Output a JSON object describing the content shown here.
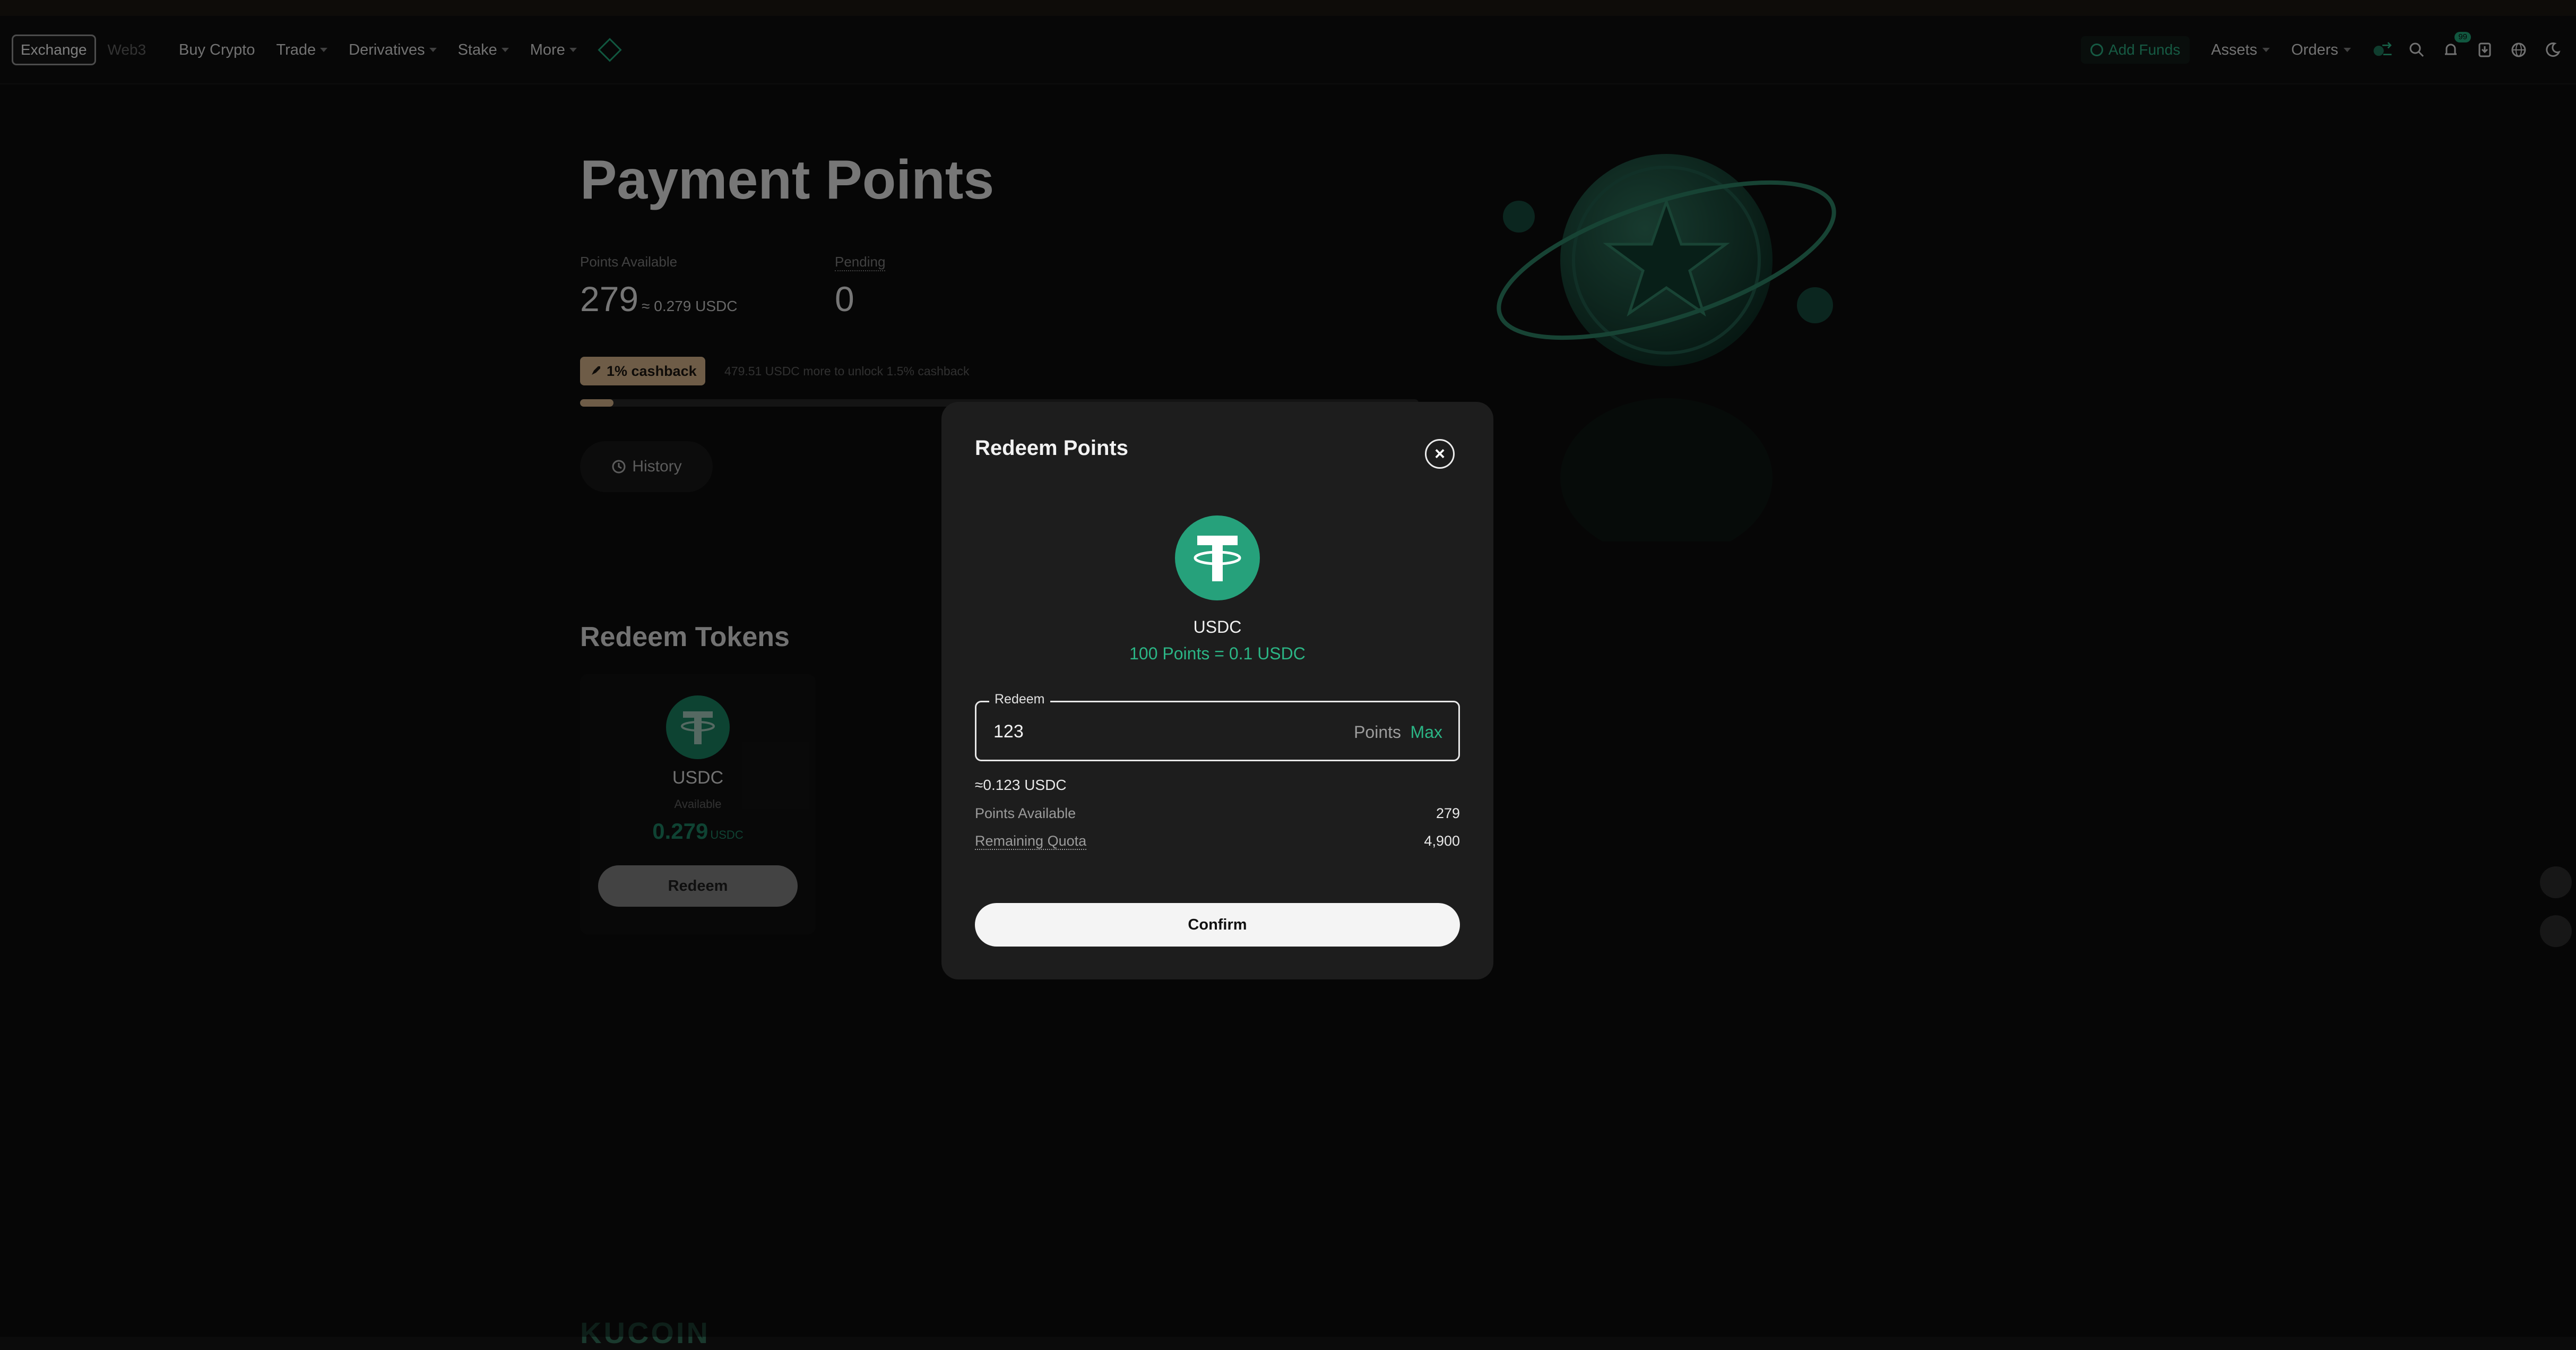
{
  "topbar": {
    "segments": {
      "exchange": "Exchange",
      "web3": "Web3"
    },
    "nav": [
      "Buy Crypto",
      "Trade",
      "Derivatives",
      "Stake",
      "More"
    ],
    "add_funds": "Add Funds",
    "assets": "Assets",
    "orders": "Orders",
    "notification_count": "99"
  },
  "page": {
    "title": "Payment Points",
    "points_available_label": "Points Available",
    "points_available_value": "279",
    "points_available_approx": "≈ 0.279 USDC",
    "pending_label": "Pending",
    "pending_value": "0",
    "cashback_badge": "1% cashback",
    "cashback_note": "479.51 USDC more to unlock 1.5% cashback",
    "cashback_progress": 0.015,
    "history_label": "History",
    "redeem_tokens_title": "Redeem Tokens",
    "footer_logo": "KUCOIN"
  },
  "token_card": {
    "name": "USDC",
    "available_label": "Available",
    "available_value": "0.279",
    "available_unit": "USDC",
    "redeem_label": "Redeem"
  },
  "modal": {
    "title": "Redeem Points",
    "token": "USDC",
    "rate": "100 Points = 0.1 USDC",
    "input_legend": "Redeem",
    "input_value": "123",
    "input_unit": "Points",
    "max_label": "Max",
    "equivalent": "≈0.123 USDC",
    "points_available_label": "Points Available",
    "points_available_value": "279",
    "remaining_quota_label": "Remaining Quota",
    "remaining_quota_value": "4,900",
    "confirm_label": "Confirm"
  },
  "colors": {
    "accent_green": "#2bb585",
    "tether_green": "#26a17b",
    "cashback_tan": "#c8a882",
    "background": "#0b0b0b",
    "modal_bg": "#1d1d1d"
  },
  "icons": [
    "diamond-icon",
    "add-funds-icon",
    "transfer-icon",
    "search-icon",
    "bell-icon",
    "download-icon",
    "globe-icon",
    "theme-moon-icon",
    "rocket-icon",
    "clock-icon",
    "tether-icon",
    "close-icon",
    "apps-icon",
    "support-icon"
  ]
}
